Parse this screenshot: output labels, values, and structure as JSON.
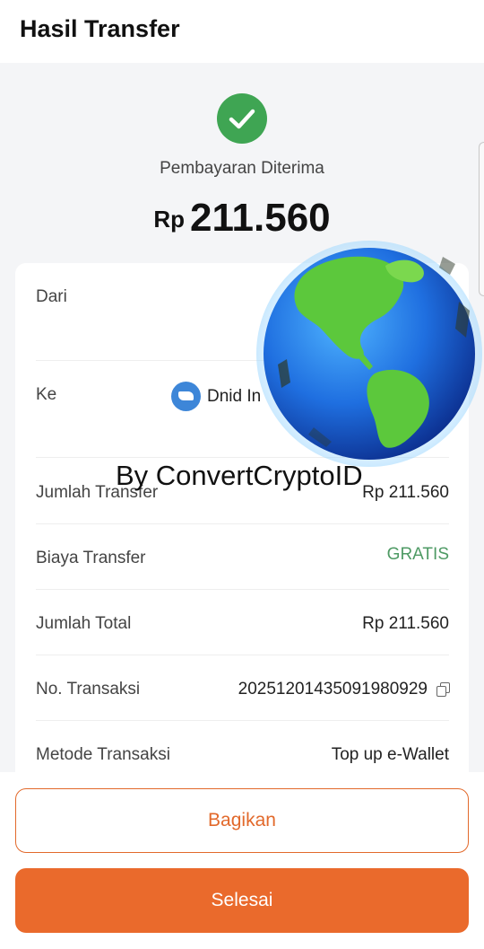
{
  "header": {
    "title": "Hasil Transfer"
  },
  "status": {
    "text": "Pembayaran Diterima",
    "icon": "check-circle-icon",
    "color": "#3fa553"
  },
  "amount": {
    "currency": "Rp",
    "value": "211.560"
  },
  "recipient": {
    "name_partial": "Dnid In",
    "logo_icon": "dana-logo-icon"
  },
  "details": {
    "from": {
      "label": "Dari"
    },
    "to": {
      "label": "Ke"
    },
    "transfer_amount": {
      "label": "Jumlah Transfer",
      "value": "Rp 211.560"
    },
    "fee": {
      "label": "Biaya Transfer",
      "value": "GRATIS"
    },
    "total": {
      "label": "Jumlah Total",
      "value": "Rp 211.560"
    },
    "transaction_no": {
      "label": "No. Transaksi",
      "value": "20251201435091980929"
    },
    "method": {
      "label": "Metode Transaksi",
      "value": "Top up e-Wallet"
    }
  },
  "watermark": {
    "text": "By ConvertCryptoID",
    "image": "globe-icon"
  },
  "buttons": {
    "share": "Bagikan",
    "done": "Selesai"
  },
  "colors": {
    "accent": "#ea6a2c",
    "success": "#3fa553",
    "free": "#4e9a64"
  }
}
